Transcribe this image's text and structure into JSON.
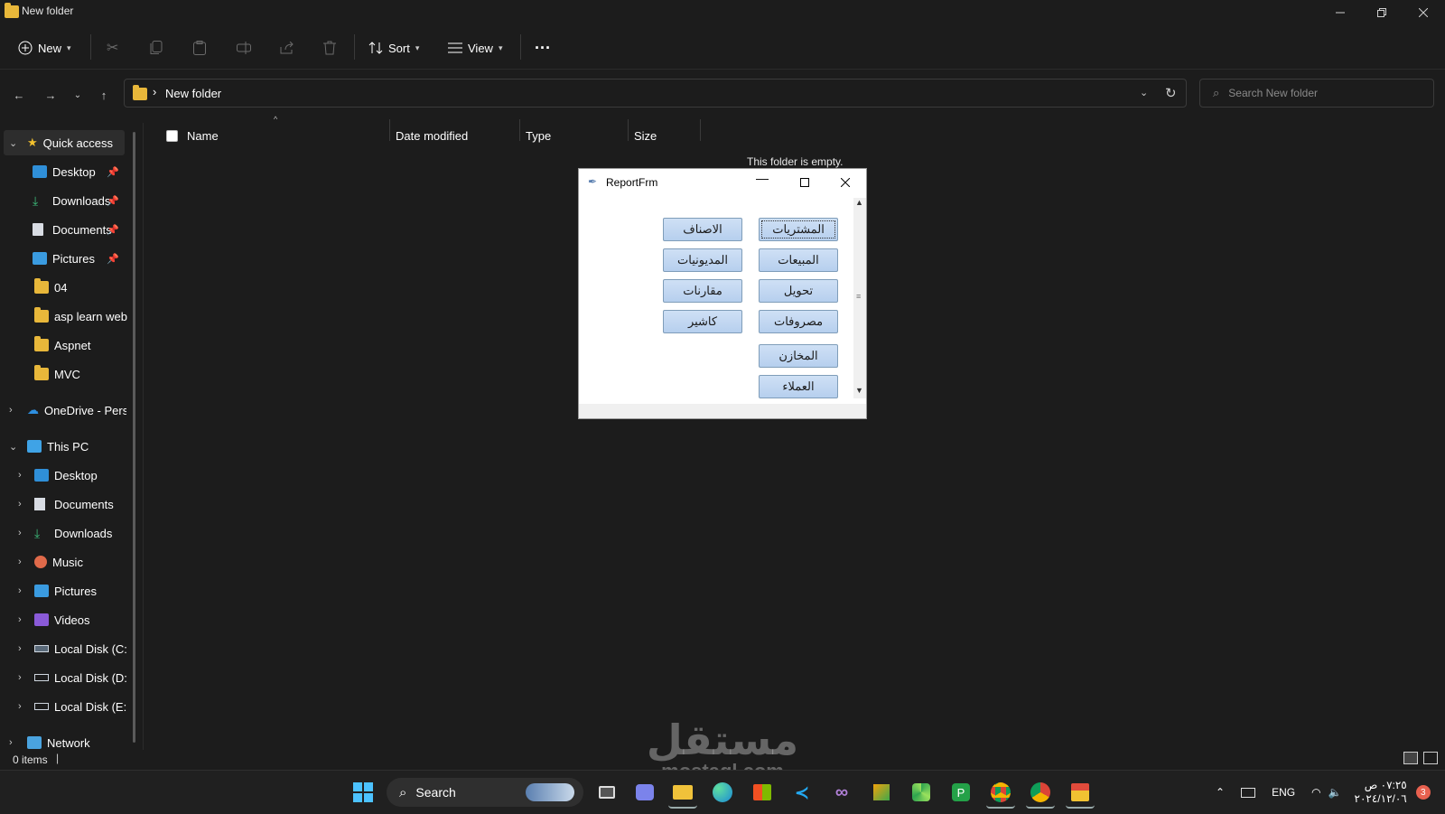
{
  "window": {
    "title": "New folder"
  },
  "commandbar": {
    "new_label": "New",
    "sort_label": "Sort",
    "view_label": "View"
  },
  "address": {
    "path": "New folder"
  },
  "search": {
    "placeholder": "Search New folder"
  },
  "sidebar": {
    "quick_access": "Quick access",
    "pinned": [
      "Desktop",
      "Downloads",
      "Documents",
      "Pictures"
    ],
    "folders": [
      "04",
      "asp learn web s",
      "Aspnet",
      "MVC"
    ],
    "onedrive": "OneDrive - Perso",
    "this_pc": "This PC",
    "pc_items": [
      "Desktop",
      "Documents",
      "Downloads",
      "Music",
      "Pictures",
      "Videos",
      "Local Disk (C:)",
      "Local Disk (D:)",
      "Local Disk (E:)"
    ],
    "network": "Network"
  },
  "columns": {
    "name": "Name",
    "date": "Date modified",
    "type": "Type",
    "size": "Size"
  },
  "content": {
    "empty_message": "This folder is empty."
  },
  "dialog": {
    "title": "ReportFrm",
    "right_buttons": [
      "المشتريات",
      "المبيعات",
      "تحويل",
      "مصروفات",
      "المخازن",
      "العملاء"
    ],
    "left_buttons": [
      "الاصناف",
      "المديونيات",
      "مقارنات",
      "كاشير"
    ]
  },
  "status": {
    "items": "0 items"
  },
  "taskbar": {
    "search_label": "Search",
    "lang": "ENG",
    "time": "٠٧:٢٥ ص",
    "date": "٢٠٢٤/١٢/٠٦",
    "notif_count": "3"
  },
  "watermark": {
    "arabic": "مستقل",
    "latin": "mostaql.com"
  }
}
